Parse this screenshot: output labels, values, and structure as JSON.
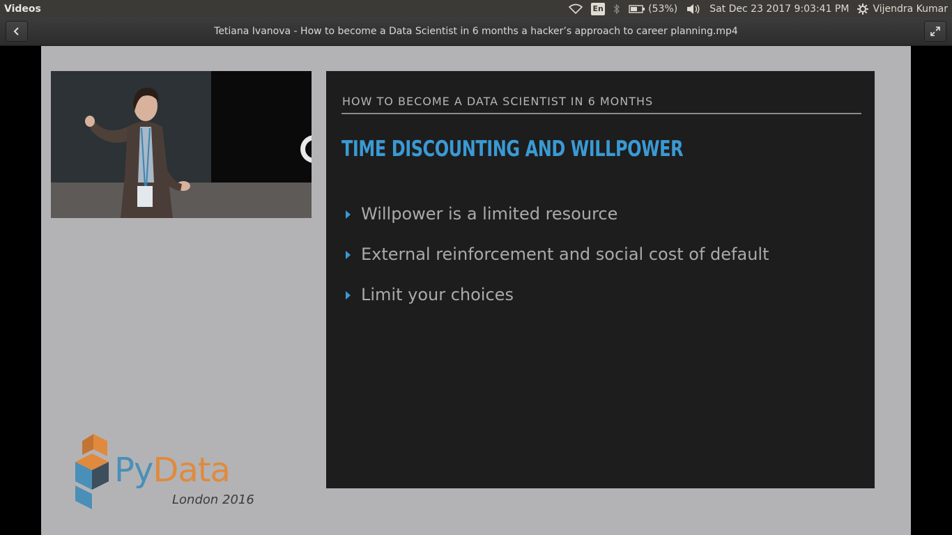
{
  "top_panel": {
    "app_name": "Videos",
    "lang": "En",
    "battery": "(53%)",
    "datetime": "Sat Dec 23 2017  9:03:41 PM",
    "user": "Vijendra Kumar"
  },
  "header": {
    "title": "Tetiana Ivanova - How to become a Data Scientist in 6 months a hacker’s approach to career planning.mp4"
  },
  "slide": {
    "kicker": "HOW TO BECOME A DATA SCIENTIST IN 6 MONTHS",
    "heading": "TIME DISCOUNTING AND WILLPOWER",
    "bullets": [
      "Willpower is a limited resource",
      "External reinforcement and social cost of default",
      "Limit your choices"
    ]
  },
  "logo": {
    "word_py": "Py",
    "word_data": "Data",
    "subtitle": "London 2016"
  },
  "colors": {
    "accent_blue": "#3a9ad4",
    "logo_orange": "#e08a3e",
    "slide_bg": "#1d1d1e",
    "frame_bg": "#b3b3b6"
  },
  "icons": [
    "wifi-icon",
    "bluetooth-icon",
    "battery-icon",
    "volume-icon",
    "gear-icon",
    "back-arrow-icon",
    "fullscreen-icon"
  ]
}
